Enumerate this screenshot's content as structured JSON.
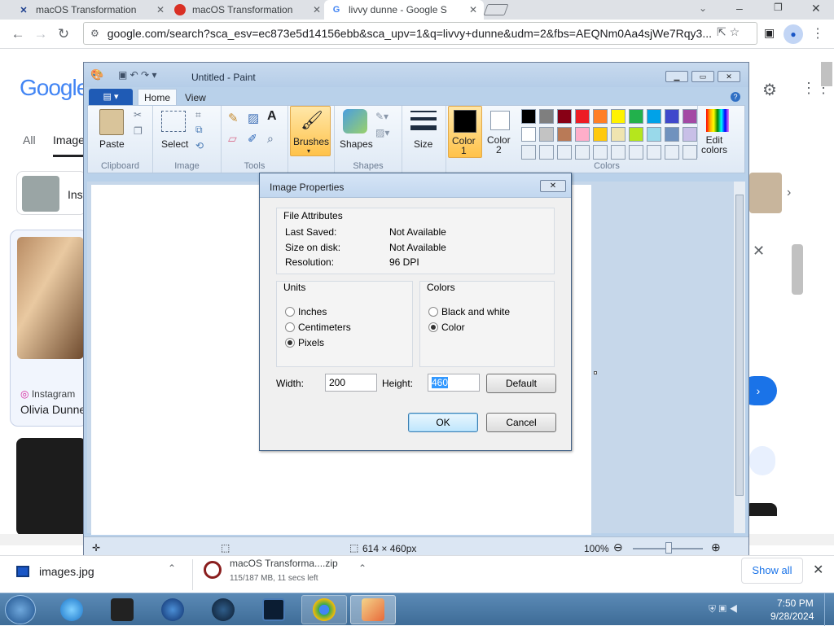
{
  "browser": {
    "tabs": [
      {
        "title": "macOS Transformation",
        "active": false
      },
      {
        "title": "macOS Transformation",
        "active": false
      },
      {
        "title": "livvy dunne - Google S",
        "active": true
      }
    ],
    "url": "google.com/search?sca_esv=ec873e5d14156ebb&sca_upv=1&q=livvy+dunne&udm=2&fbs=AEQNm0Aa4sjWe7Rqy3..."
  },
  "google": {
    "logo": "Google",
    "nav_all": "All",
    "nav_images": "Images",
    "chip_label": "Inst",
    "result1_source": "Instagram",
    "result1_title": "Olivia Dunne"
  },
  "paint": {
    "title": "Untitled - Paint",
    "tabs": {
      "home": "Home",
      "view": "View"
    },
    "groups": {
      "clipboard": "Clipboard",
      "image": "Image",
      "tools": "Tools",
      "shapes": "Shapes",
      "colors": "Colors"
    },
    "buttons": {
      "paste": "Paste",
      "select": "Select",
      "brushes": "Brushes",
      "shapes": "Shapes",
      "size": "Size",
      "color1": "Color\n1",
      "color2": "Color\n2",
      "edit_colors": "Edit\ncolors"
    },
    "palette_row1": [
      "#000000",
      "#7f7f7f",
      "#880015",
      "#ed1c24",
      "#ff7f27",
      "#fff200",
      "#22b14c",
      "#00a2e8",
      "#3f48cc",
      "#a349a4"
    ],
    "palette_row2": [
      "#ffffff",
      "#c3c3c3",
      "#b97a57",
      "#ffaec9",
      "#ffc90e",
      "#efe4b0",
      "#b5e61d",
      "#99d9ea",
      "#7092be",
      "#c8bfe7"
    ],
    "status_size": "614 × 460px",
    "zoom": "100%"
  },
  "dialog": {
    "title": "Image Properties",
    "file_attributes": "File Attributes",
    "last_saved_label": "Last Saved:",
    "last_saved_value": "Not Available",
    "size_label": "Size on disk:",
    "size_value": "Not Available",
    "resolution_label": "Resolution:",
    "resolution_value": "96 DPI",
    "units": "Units",
    "inches": "Inches",
    "centimeters": "Centimeters",
    "pixels": "Pixels",
    "colors": "Colors",
    "bw": "Black and white",
    "color": "Color",
    "width_label": "Width:",
    "width_value": "200",
    "height_label": "Height:",
    "height_value": "460",
    "default_btn": "Default",
    "ok_btn": "OK",
    "cancel_btn": "Cancel"
  },
  "downloads": {
    "item1": "images.jpg",
    "item2_name": "macOS Transforma....zip",
    "item2_progress": "115/187 MB, 11 secs left",
    "show_all": "Show all"
  },
  "taskbar": {
    "time": "7:50 PM",
    "date": "9/28/2024"
  }
}
